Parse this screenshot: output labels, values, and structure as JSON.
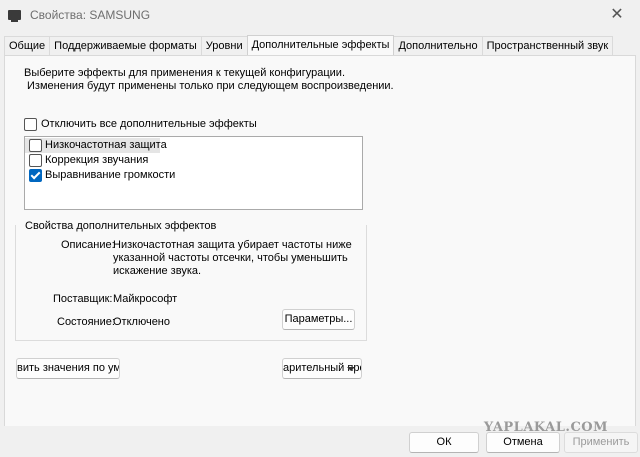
{
  "window": {
    "title": "Свойства: SAMSUNG",
    "close_glyph": "✕"
  },
  "tabs": [
    {
      "label": "Общие",
      "active": false
    },
    {
      "label": "Поддерживаемые форматы",
      "active": false
    },
    {
      "label": "Уровни",
      "active": false
    },
    {
      "label": "Дополнительные эффекты",
      "active": true
    },
    {
      "label": "Дополнительно",
      "active": false
    },
    {
      "label": "Пространственный звук",
      "active": false
    }
  ],
  "enhancements": {
    "instruction_line1": "Выберите эффекты для применения к текущей конфигурации.",
    "instruction_line2": "Изменения будут применены только при следующем воспроизведении.",
    "disable_all_label": "Отключить все дополнительные эффекты",
    "disable_all_checked": false,
    "items": [
      {
        "label": "Низкочастотная защита",
        "checked": false,
        "selected": true
      },
      {
        "label": "Коррекция звучания",
        "checked": false,
        "selected": false
      },
      {
        "label": "Выравнивание громкости",
        "checked": true,
        "selected": false
      }
    ]
  },
  "properties": {
    "group_title": "Свойства дополнительных эффектов",
    "description_label": "Описание:",
    "description_line1": "Низкочастотная защита убирает частоты ниже",
    "description_line2": "указанной частоты отсечки, чтобы уменьшить",
    "description_line3": "искажение звука.",
    "provider_label": "Поставщик:",
    "provider_value": "Майкрософт",
    "status_label": "Состояние:",
    "status_value": "Отключено",
    "settings_button": "Параметры..."
  },
  "buttons": {
    "restore_defaults": "вить значения по ум",
    "preview": "арительный про",
    "ok": "ОК",
    "cancel": "Отмена",
    "apply": "Применить"
  },
  "watermark": "YAPLAKAL.COM",
  "icons": {
    "app": "speaker-device-icon",
    "close": "close-icon",
    "check": "checkmark-icon"
  },
  "colors": {
    "accent": "#0067c0",
    "panel": "#f9f9f9",
    "window": "#f0f0f0"
  }
}
